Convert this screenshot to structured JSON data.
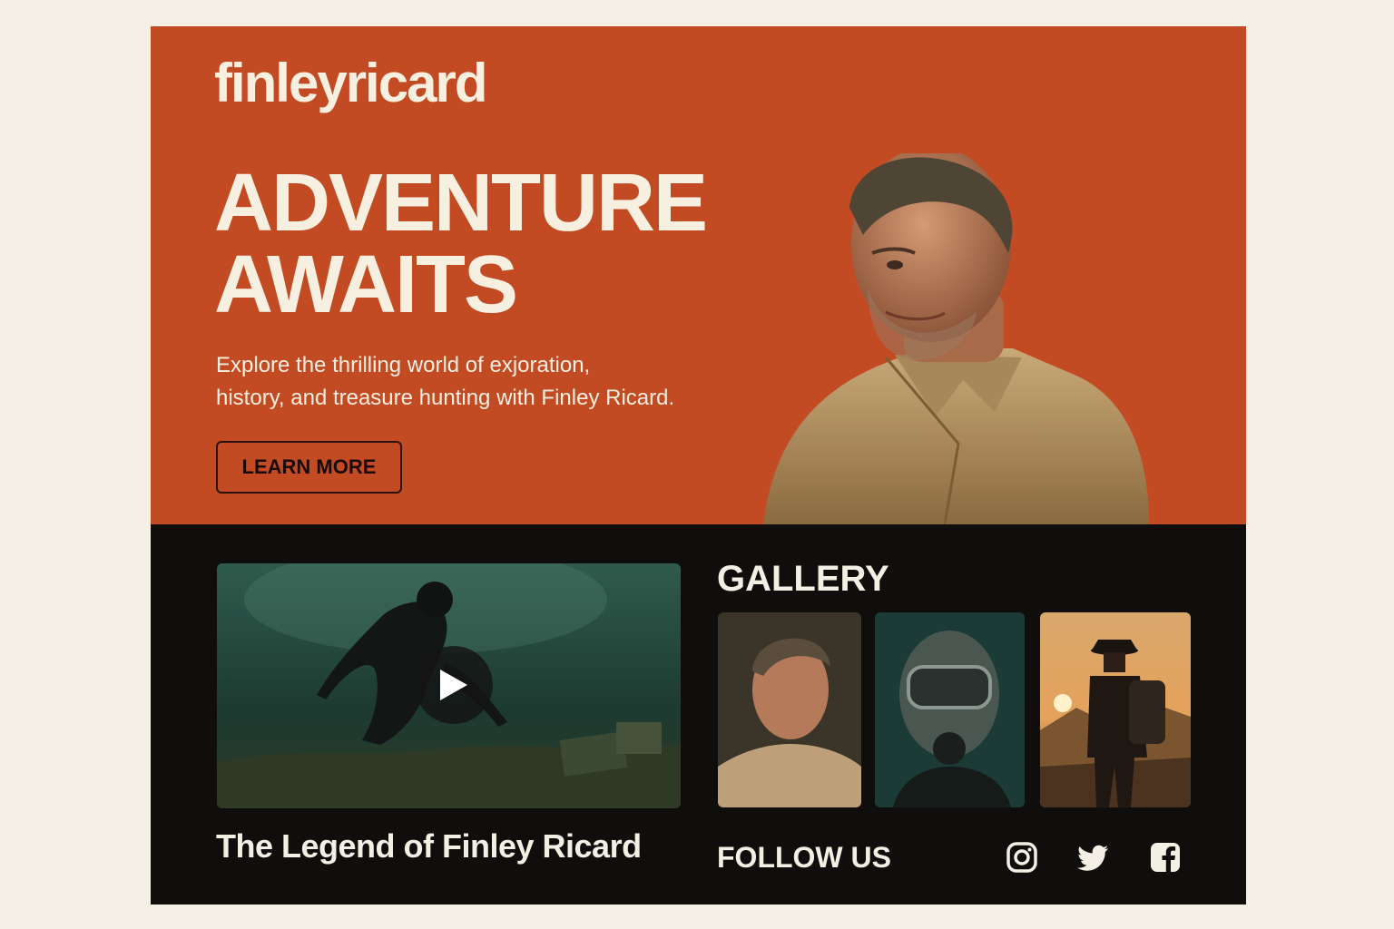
{
  "brand": {
    "logo": "finleyricard"
  },
  "hero": {
    "headline_line1": "ADVENTURE",
    "headline_line2": "AWAITS",
    "intro_line1": "Explore the thrilling world of exjoration,",
    "intro_line2": "history, and treasure hunting with Finley Ricard.",
    "cta_label": "LEARN MORE"
  },
  "video": {
    "title": "The Legend of Finley Ricard",
    "play_icon": "play-icon"
  },
  "gallery": {
    "title": "GALLERY",
    "items": [
      {
        "name": "explorer-portrait"
      },
      {
        "name": "diver-portrait"
      },
      {
        "name": "hiker-at-sunset"
      }
    ]
  },
  "social": {
    "title": "FOLLOW US",
    "icons": [
      "instagram-icon",
      "twitter-icon",
      "facebook-icon"
    ]
  },
  "colors": {
    "page_bg": "#f4f0e6",
    "hero_bg": "#c24b24",
    "lower_bg": "#0f0e0c",
    "text_light": "#f7efe0"
  }
}
